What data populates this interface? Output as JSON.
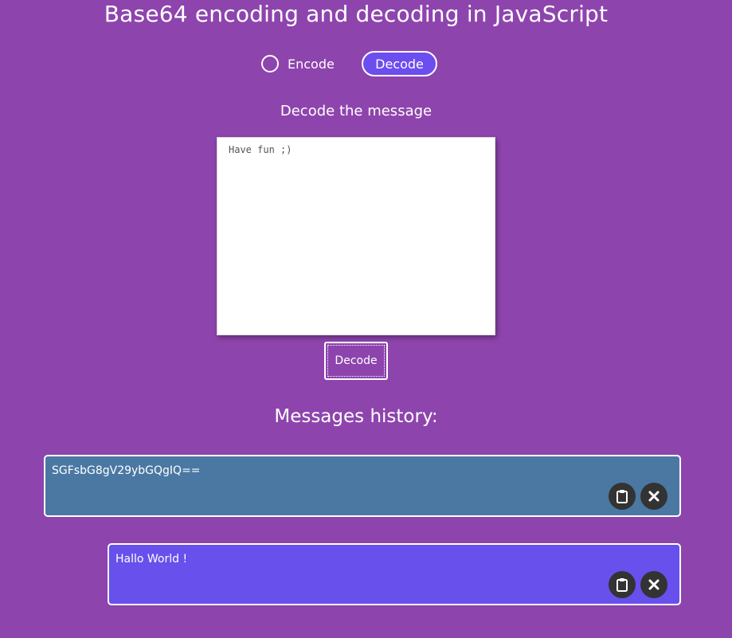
{
  "page": {
    "title": "Base64 encoding and decoding in JavaScript"
  },
  "mode_switch": {
    "options": [
      {
        "label": "Encode",
        "selected": false
      },
      {
        "label": "Decode",
        "selected": true
      }
    ]
  },
  "editor": {
    "subtitle": "Decode the message",
    "placeholder": "Have fun ;)",
    "value": "",
    "submit_label": "Decode"
  },
  "history": {
    "title": "Messages history:",
    "items": [
      {
        "text": "SGFsbG8gV29ybGQgIQ==",
        "color": "#4a78a3",
        "actions": [
          "clipboard-icon",
          "close-icon"
        ]
      },
      {
        "text": "Hallo World !",
        "color": "#6750ec",
        "actions": [
          "clipboard-icon",
          "close-icon"
        ]
      }
    ]
  },
  "colors": {
    "background": "#8e44ad",
    "accent": "#6c4df0",
    "encoded_item": "#4a78a3",
    "decoded_item": "#6750ec",
    "action_button": "#333333"
  }
}
